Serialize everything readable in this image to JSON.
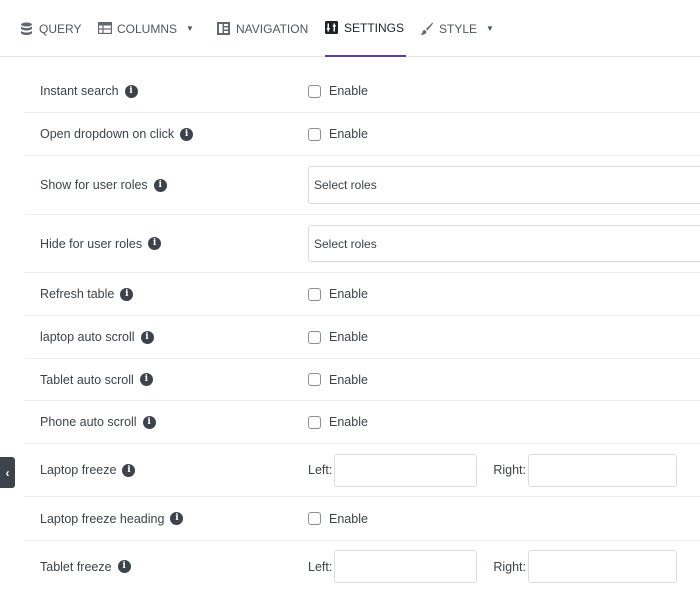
{
  "tabs": [
    {
      "label": "QUERY",
      "icon": "database-icon"
    },
    {
      "label": "COLUMNS",
      "icon": "table-icon"
    },
    {
      "label": "NAVIGATION",
      "icon": "navigation-icon"
    },
    {
      "label": "SETTINGS",
      "icon": "settings-icon",
      "active": true
    },
    {
      "label": "STYLE",
      "icon": "brush-icon"
    }
  ],
  "accent_color": "#5b3fa8",
  "settings": {
    "instant_search": {
      "label": "Instant search",
      "option": "Enable",
      "checked": false
    },
    "open_dropdown": {
      "label": "Open dropdown on click",
      "option": "Enable",
      "checked": false
    },
    "show_roles": {
      "label": "Show for user roles",
      "placeholder": "Select roles"
    },
    "hide_roles": {
      "label": "Hide for user roles",
      "placeholder": "Select roles"
    },
    "refresh_table": {
      "label": "Refresh table",
      "option": "Enable",
      "checked": false
    },
    "laptop_scroll": {
      "label": "laptop auto scroll",
      "option": "Enable",
      "checked": false
    },
    "tablet_scroll": {
      "label": "Tablet auto scroll",
      "option": "Enable",
      "checked": false
    },
    "phone_scroll": {
      "label": "Phone auto scroll",
      "option": "Enable",
      "checked": false
    },
    "laptop_freeze": {
      "label": "Laptop freeze",
      "left_label": "Left:",
      "right_label": "Right:"
    },
    "laptop_freeze_heading": {
      "label": "Laptop freeze heading",
      "option": "Enable",
      "checked": false
    },
    "tablet_freeze": {
      "label": "Tablet freeze",
      "left_label": "Left:",
      "right_label": "Right:"
    }
  },
  "collapse_glyph": "‹"
}
